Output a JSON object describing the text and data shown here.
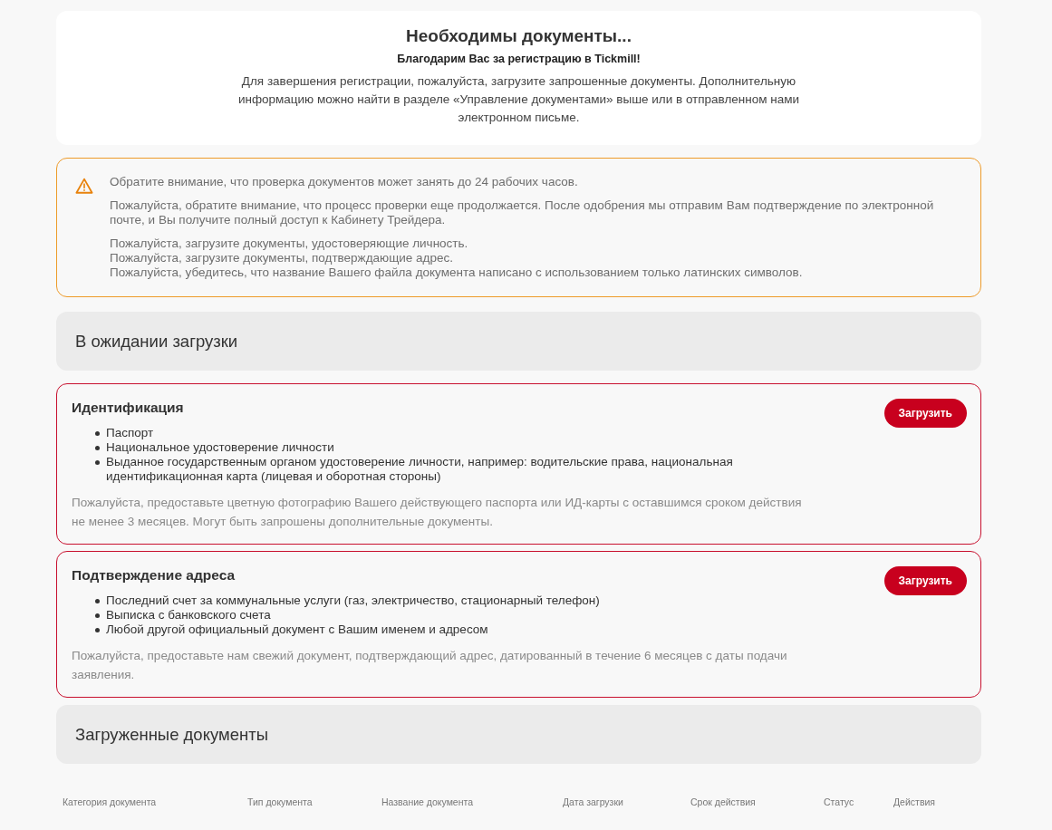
{
  "intro": {
    "title": "Необходимы документы...",
    "subtitle": "Благодарим Вас за регистрацию в Tickmill!",
    "text": "Для завершения регистрации, пожалуйста, загрузите запрошенные документы. Дополнительную информацию можно найти в разделе «Управление документами» выше или в отправленном нами электронном письме."
  },
  "notice": {
    "paragraphs": [
      [
        "Обратите внимание, что проверка документов может занять до 24 рабочих часов."
      ],
      [
        "Пожалуйста, обратите внимание, что процесс проверки еще продолжается. После одобрения мы отправим Вам подтверждение по электронной почте, и Вы получите полный доступ к Кабинету Трейдера."
      ],
      [
        "Пожалуйста, загрузите документы, удостоверяющие личность.",
        "Пожалуйста, загрузите документы, подтверждающие адрес.",
        "Пожалуйста, убедитесь, что название Вашего файла документа написано с использованием только латинских символов."
      ]
    ]
  },
  "pending": {
    "title": "В ожидании загрузки",
    "documents": [
      {
        "title": "Идентификация",
        "items": [
          "Паспорт",
          "Национальное удостоверение личности",
          "Выданное государственным органом удостоверение личности, например: водительские права, национальная идентификационная карта (лицевая и оборотная стороны)"
        ],
        "note": "Пожалуйста, предоставьте цветную фотографию Вашего действующего паспорта или ИД-карты с оставшимся сроком действия не менее 3 месяцев. Могут быть запрошены дополнительные документы.",
        "button": "Загрузить"
      },
      {
        "title": "Подтверждение адреса",
        "items": [
          "Последний счет за коммунальные услуги (газ, электричество, стационарный телефон)",
          "Выписка с банковского счета",
          "Любой другой официальный документ с Вашим именем и адресом"
        ],
        "note": "Пожалуйста, предоставьте нам свежий документ, подтверждающий адрес, датированный в течение 6 месяцев с даты подачи заявления.",
        "button": "Загрузить"
      }
    ]
  },
  "uploaded": {
    "title": "Загруженные документы",
    "table": {
      "columns": [
        "Категория документа",
        "Тип документа",
        "Название документа",
        "Дата загрузки",
        "Срок действия",
        "Статус",
        "Действия"
      ]
    }
  }
}
